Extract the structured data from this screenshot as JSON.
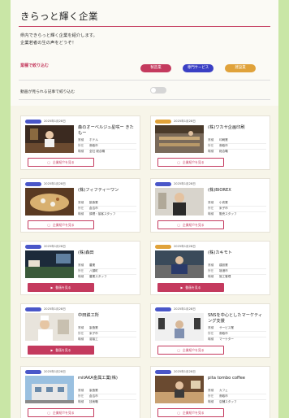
{
  "header": {
    "title": "きらっと輝く企業"
  },
  "intro": {
    "line1": "県内できらっと輝く企業を紹介します。",
    "line2": "企業若者の生の声をどうぞ！"
  },
  "filter": {
    "label": "業種で絞り込む",
    "pills": [
      {
        "label": "製造業",
        "color": "#c43a5e"
      },
      {
        "label": "専門サービス",
        "color": "#3a3fc4"
      },
      {
        "label": "建設業",
        "color": "#e0a23a"
      }
    ]
  },
  "toggle": {
    "label": "動画が見られる記事で絞り込む"
  },
  "keys": {
    "gyoshu": "業種",
    "shozai": "所在",
    "kigyo": "職種"
  },
  "buttons": {
    "article": "企業紹介を見る",
    "video": "動画を見る",
    "article_icon": "▢",
    "video_icon": "▶"
  },
  "cards": [
    {
      "date": "2025年1月28日",
      "name": "森のオーベルジュ星咲ー きたもー",
      "gyoshu": "ホテル",
      "shozai": "鳥取市",
      "kigyo": "全社 総合職",
      "button": "article",
      "badge_color": "#4a57c9",
      "thumb": "restaurant"
    },
    {
      "date": "2025年1月28日",
      "name": "(株)ワカサ企画印刷",
      "gyoshu": "印刷業",
      "shozai": "鳥取市",
      "kigyo": "総合職",
      "button": "article",
      "badge_color": "#e0a23a",
      "thumb": "office"
    },
    {
      "date": "2025年1月28日",
      "name": "(株)フィフティーワン",
      "gyoshu": "飲食業",
      "shozai": "倉吉市",
      "kigyo": "調理・接客スタッフ",
      "button": "article",
      "badge_color": "#4a57c9",
      "thumb": "food"
    },
    {
      "date": "2025年1月28日",
      "name": "(株)BIOREX",
      "gyoshu": "小売業",
      "shozai": "米子市",
      "kigyo": "販売スタッフ",
      "button": "article",
      "badge_color": "#4a57c9",
      "thumb": "person"
    },
    {
      "date": "2025年1月28日",
      "name": "(株)森田",
      "gyoshu": "農業",
      "shozai": "八頭町",
      "kigyo": "農業スタッフ",
      "button": "video",
      "badge_color": "#4a57c9",
      "thumb": "field"
    },
    {
      "date": "2025年1月28日",
      "name": "(株)カキモト",
      "gyoshu": "建設業",
      "shozai": "境港市",
      "kigyo": "施工管理",
      "button": "video",
      "badge_color": "#e0a23a",
      "thumb": "site"
    },
    {
      "date": "2025年1月28日",
      "name": "中田鉄工所",
      "gyoshu": "製造業",
      "shozai": "米子市",
      "kigyo": "溶接工",
      "button": "video",
      "badge_color": "#4a57c9",
      "thumb": "chef"
    },
    {
      "date": "2025年1月28日",
      "name": "SNSを中心としたマーケティング支援",
      "gyoshu": "サービス業",
      "shozai": "鳥取市",
      "kigyo": "マーケター",
      "button": "article",
      "badge_color": "#4a57c9",
      "thumb": "studio"
    },
    {
      "date": "2025年1月28日",
      "name": "mitAKA金属工業(株)",
      "gyoshu": "製造業",
      "shozai": "倉吉市",
      "kigyo": "技術職",
      "button": "article",
      "badge_color": "#4a57c9",
      "thumb": "building"
    },
    {
      "date": "2025年1月28日",
      "name": "pita tombo coffee",
      "gyoshu": "カフェ",
      "shozai": "鳥取市",
      "kigyo": "店舗スタッフ",
      "button": "article",
      "badge_color": "#4a57c9",
      "thumb": "cafe"
    }
  ]
}
